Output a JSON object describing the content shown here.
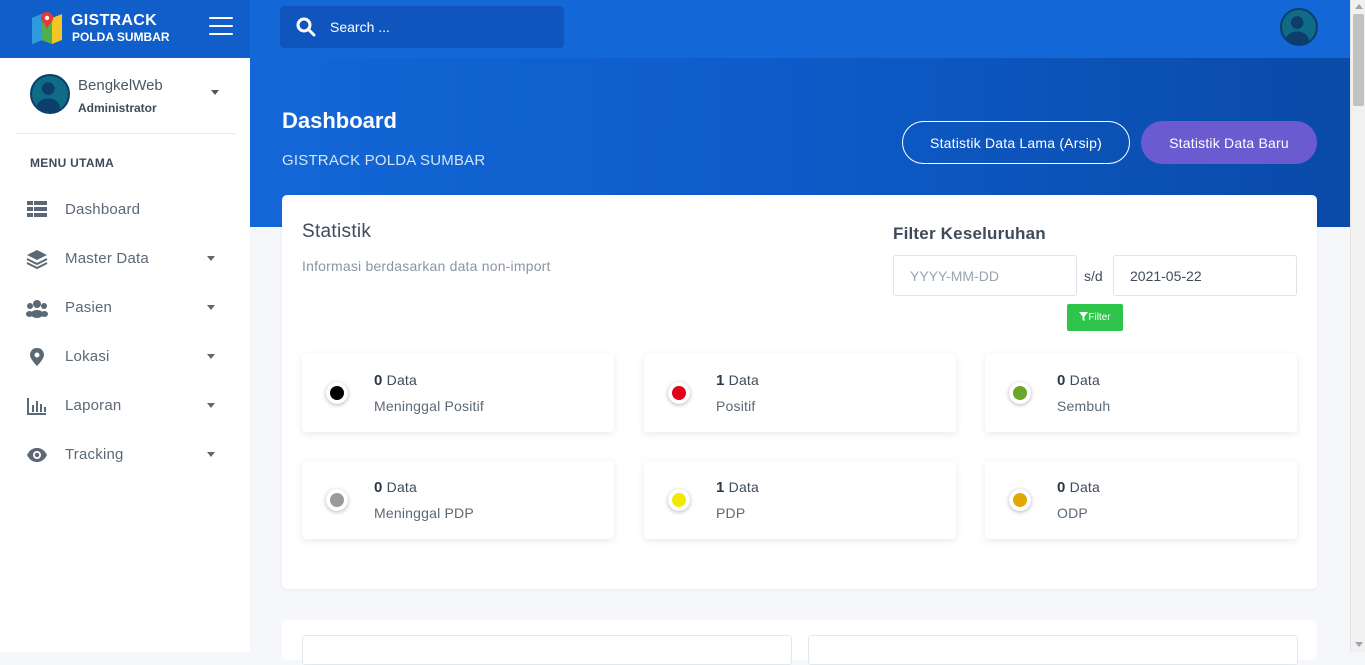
{
  "brand": {
    "title": "GISTRACK",
    "subtitle": "POLDA SUMBAR",
    "logo_icon": "map-pin-logo-icon"
  },
  "search": {
    "placeholder": "Search ..."
  },
  "user": {
    "name": "BengkelWeb",
    "role": "Administrator"
  },
  "sidebar": {
    "menu_title": "MENU UTAMA",
    "items": [
      {
        "label": "Dashboard",
        "icon": "table-icon",
        "has_caret": false
      },
      {
        "label": "Master Data",
        "icon": "layers-icon",
        "has_caret": true
      },
      {
        "label": "Pasien",
        "icon": "users-icon",
        "has_caret": true
      },
      {
        "label": "Lokasi",
        "icon": "map-marker-icon",
        "has_caret": true
      },
      {
        "label": "Laporan",
        "icon": "bar-chart-icon",
        "has_caret": true
      },
      {
        "label": "Tracking",
        "icon": "eye-icon",
        "has_caret": true
      }
    ]
  },
  "header": {
    "title": "Dashboard",
    "subtitle": "GISTRACK POLDA SUMBAR",
    "btn_old": "Statistik Data Lama (Arsip)",
    "btn_new": "Statistik Data Baru"
  },
  "statistik": {
    "title": "Statistik",
    "description": "Informasi berdasarkan data non-import"
  },
  "filter": {
    "title": "Filter Keseluruhan",
    "from_placeholder": "YYYY-MM-DD",
    "from_value": "",
    "separator": "s/d",
    "to_value": "2021-05-22",
    "button_label": "Filter"
  },
  "stats": [
    {
      "count": "0",
      "unit": "Data",
      "label": "Meninggal Positif",
      "color": "#000000"
    },
    {
      "count": "1",
      "unit": "Data",
      "label": "Positif",
      "color": "#e3001b"
    },
    {
      "count": "0",
      "unit": "Data",
      "label": "Sembuh",
      "color": "#6aa52c"
    },
    {
      "count": "0",
      "unit": "Data",
      "label": "Meninggal PDP",
      "color": "#9a9a9a"
    },
    {
      "count": "1",
      "unit": "Data",
      "label": "PDP",
      "color": "#f2e800"
    },
    {
      "count": "0",
      "unit": "Data",
      "label": "ODP",
      "color": "#e3a800"
    }
  ],
  "colors": {
    "topbar": "#1467d7",
    "accent_purple": "#6c5bd0",
    "filter_green": "#2fc44a"
  }
}
